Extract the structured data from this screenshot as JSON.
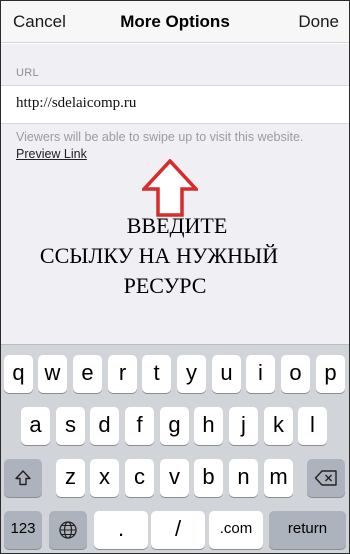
{
  "nav": {
    "cancel": "Cancel",
    "title": "More Options",
    "done": "Done"
  },
  "section": {
    "label": "URL"
  },
  "url": {
    "value": "http://sdelaicomp.ru"
  },
  "hint": "Viewers will be able to swipe up to visit this website.",
  "preview_link": "Preview Link",
  "annotation": {
    "line1": "ВВЕДИТЕ",
    "line2": "ССЫЛКУ НА НУЖНЫЙ",
    "line3": "РЕСУРС",
    "arrow_color": "#d62c2c"
  },
  "keyboard": {
    "row1": [
      "q",
      "w",
      "e",
      "r",
      "t",
      "y",
      "u",
      "i",
      "o",
      "p"
    ],
    "row2": [
      "a",
      "s",
      "d",
      "f",
      "g",
      "h",
      "j",
      "k",
      "l"
    ],
    "row3": [
      "z",
      "x",
      "c",
      "v",
      "b",
      "n",
      "m"
    ],
    "shift_icon": "shift-icon",
    "delete_icon": "backspace-icon",
    "numbers": "123",
    "globe_icon": "globe-icon",
    "dot": ".",
    "slash": "/",
    "dotcom": ".com",
    "return": "return"
  }
}
